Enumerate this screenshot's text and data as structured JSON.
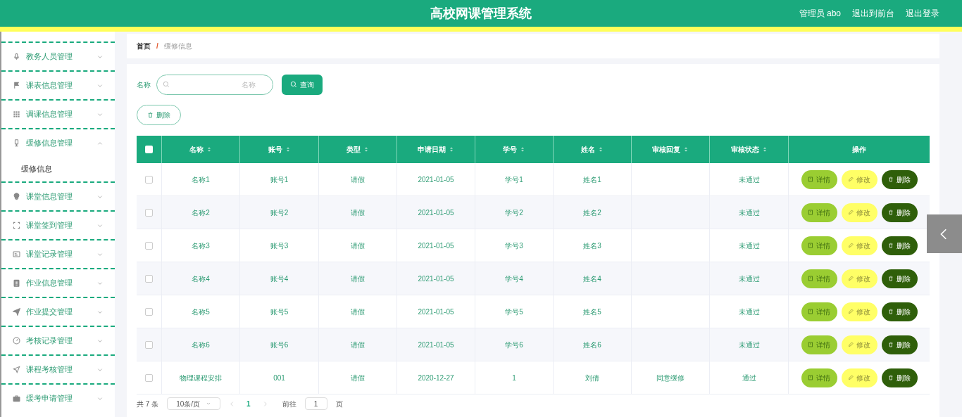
{
  "header": {
    "title": "高校网课管理系统",
    "links": [
      "管理员 abo",
      "退出到前台",
      "退出登录"
    ]
  },
  "sidebar": {
    "items": [
      {
        "label": "教务人员管理",
        "expanded": false
      },
      {
        "label": "课表信息管理",
        "expanded": false
      },
      {
        "label": "调课信息管理",
        "expanded": false
      },
      {
        "label": "缓修信息管理",
        "expanded": true,
        "children": [
          {
            "label": "缓修信息",
            "selected": true
          }
        ]
      },
      {
        "label": "课堂信息管理",
        "expanded": false
      },
      {
        "label": "课堂签到管理",
        "expanded": false
      },
      {
        "label": "课堂记录管理",
        "expanded": false
      },
      {
        "label": "作业信息管理",
        "expanded": false
      },
      {
        "label": "作业提交管理",
        "expanded": false
      },
      {
        "label": "考核记录管理",
        "expanded": false
      },
      {
        "label": "课程考核管理",
        "expanded": false
      },
      {
        "label": "缓考申请管理",
        "expanded": false
      }
    ]
  },
  "breadcrumb": {
    "separator": "/",
    "items": [
      "首页",
      "缓修信息"
    ]
  },
  "search": {
    "label": "名称",
    "placeholder": "名称",
    "button": "查询"
  },
  "delete_button": "删除",
  "table": {
    "select_all": {
      "checked": false
    },
    "columns": [
      {
        "label": "名称",
        "sortable": true
      },
      {
        "label": "账号",
        "sortable": true
      },
      {
        "label": "类型",
        "sortable": true
      },
      {
        "label": "申请日期",
        "sortable": true
      },
      {
        "label": "学号",
        "sortable": true
      },
      {
        "label": "姓名",
        "sortable": true
      },
      {
        "label": "审核回复",
        "sortable": true
      },
      {
        "label": "审核状态",
        "sortable": true
      },
      {
        "label": "操作",
        "sortable": false
      }
    ],
    "rows": [
      {
        "checked": false,
        "cells": [
          "名称1",
          "账号1",
          "请假",
          "2021-01-05",
          "学号1",
          "姓名1",
          "",
          "未通过"
        ],
        "actions": [
          {
            "kind": "detail",
            "label": "详情"
          },
          {
            "kind": "edit",
            "label": "修改"
          },
          {
            "kind": "delete",
            "label": "删除"
          }
        ]
      },
      {
        "checked": false,
        "cells": [
          "名称2",
          "账号2",
          "请假",
          "2021-01-05",
          "学号2",
          "姓名2",
          "",
          "未通过"
        ],
        "actions": [
          {
            "kind": "detail",
            "label": "详情"
          },
          {
            "kind": "edit",
            "label": "修改"
          },
          {
            "kind": "delete",
            "label": "删除"
          }
        ]
      },
      {
        "checked": false,
        "cells": [
          "名称3",
          "账号3",
          "请假",
          "2021-01-05",
          "学号3",
          "姓名3",
          "",
          "未通过"
        ],
        "actions": [
          {
            "kind": "detail",
            "label": "详情"
          },
          {
            "kind": "edit",
            "label": "修改"
          },
          {
            "kind": "delete",
            "label": "删除"
          }
        ]
      },
      {
        "checked": false,
        "cells": [
          "名称4",
          "账号4",
          "请假",
          "2021-01-05",
          "学号4",
          "姓名4",
          "",
          "未通过"
        ],
        "actions": [
          {
            "kind": "detail",
            "label": "详情"
          },
          {
            "kind": "edit",
            "label": "修改"
          },
          {
            "kind": "delete",
            "label": "删除"
          }
        ]
      },
      {
        "checked": false,
        "cells": [
          "名称5",
          "账号5",
          "请假",
          "2021-01-05",
          "学号5",
          "姓名5",
          "",
          "未通过"
        ],
        "actions": [
          {
            "kind": "detail",
            "label": "详情"
          },
          {
            "kind": "edit",
            "label": "修改"
          },
          {
            "kind": "delete",
            "label": "删除"
          }
        ]
      },
      {
        "checked": false,
        "cells": [
          "名称6",
          "账号6",
          "请假",
          "2021-01-05",
          "学号6",
          "姓名6",
          "",
          "未通过"
        ],
        "actions": [
          {
            "kind": "detail",
            "label": "详情"
          },
          {
            "kind": "edit",
            "label": "修改"
          },
          {
            "kind": "delete",
            "label": "删除"
          }
        ]
      },
      {
        "checked": false,
        "cells": [
          "物理课程安排",
          "001",
          "请假",
          "2020-12-27",
          "1",
          "刘倩",
          "同意缓修",
          "通过"
        ],
        "actions": [
          {
            "kind": "detail",
            "label": "详情"
          },
          {
            "kind": "edit",
            "label": "修改"
          },
          {
            "kind": "delete",
            "label": "删除"
          }
        ]
      }
    ]
  },
  "pagination": {
    "total": "共 7 条",
    "page_size": "10条/页",
    "pages": [
      {
        "label": "1",
        "selected": true
      }
    ],
    "goto_label": "前往",
    "goto_value": "1",
    "goto_suffix": "页"
  }
}
